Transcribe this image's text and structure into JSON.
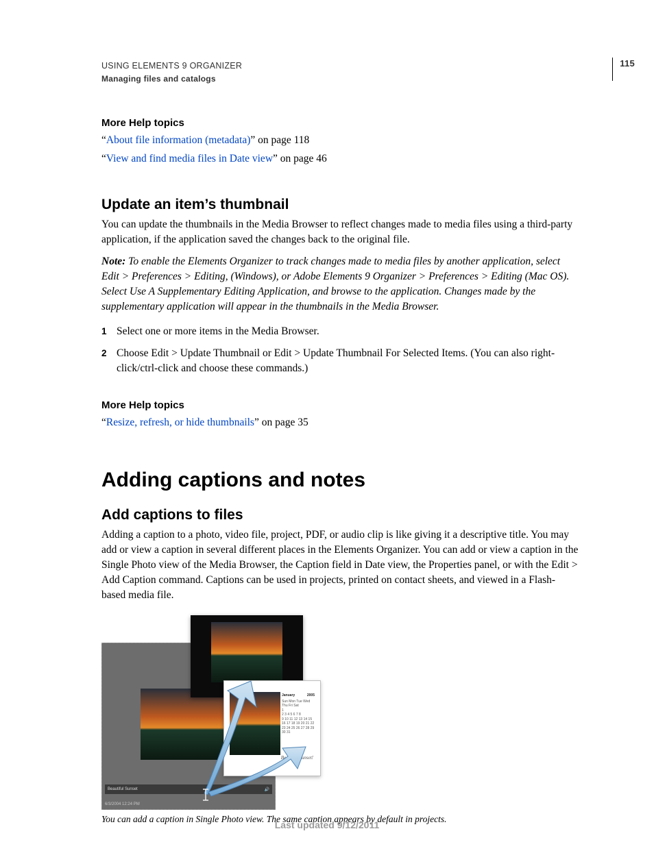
{
  "header": {
    "line1": "USING ELEMENTS 9 ORGANIZER",
    "line2": "Managing files and catalogs",
    "page_number": "115"
  },
  "sections": {
    "help1": {
      "heading": "More Help topics",
      "links": [
        {
          "quote_open": "“",
          "text": "About file information (metadata)",
          "tail": "” on page 118"
        },
        {
          "quote_open": "“",
          "text": "View and find media files in Date view",
          "tail": "” on page 46"
        }
      ]
    },
    "updateThumb": {
      "heading": "Update an item’s thumbnail",
      "body": "You can update the thumbnails in the Media Browser to reflect changes made to media files using a third-party application, if the application saved the changes back to the original file.",
      "note_label": "Note:",
      "note_body": " To enable the Elements Organizer to track changes made to media files by another application, select Edit > Preferences > Editing, (Windows), or Adobe Elements 9 Organizer > Preferences > Editing (Mac OS). Select Use A Supplementary Editing Application, and browse to the application. Changes made by the supplementary application will appear in the thumbnails in the Media Browser.",
      "steps": [
        "Select one or more items in the Media Browser.",
        "Choose Edit > Update Thumbnail or Edit > Update Thumbnail For Selected Items. (You can also right-click/ctrl-click and choose these commands.)"
      ]
    },
    "help2": {
      "heading": "More Help topics",
      "links": [
        {
          "quote_open": "“",
          "text": "Resize, refresh, or hide thumbnails",
          "tail": "” on page 35"
        }
      ]
    },
    "chapter": {
      "title": "Adding captions and notes"
    },
    "addCaptions": {
      "heading": "Add captions to files",
      "body": "Adding a caption to a photo, video file, project, PDF, or audio clip is like giving it a descriptive title. You may add or view a caption in several different places in the Elements Organizer. You can add or view a caption in the Single Photo view of the Media Browser, the Caption field in Date view, the Properties panel, or with the Edit > Add Caption command. Captions can be used in projects, printed on contact sheets, and viewed in a Flash-based media file."
    },
    "figure": {
      "caption_text": "Beautiful sunset!",
      "beautiful_label": "Beautiful Sunset",
      "timestamp_label": "6/3/2004 12:24 PM",
      "calendar": {
        "month": "January",
        "year": "2005",
        "dow": "Sun Mon Tue Wed Thu Fri Sat",
        "row1": "                              1",
        "row2": "2   3   4   5   6   7   8",
        "row3": "9  10  11  12  13  14  15",
        "row4": "16 17 18 19 20 21 22",
        "row5": "23 24 25 26 27 28 29",
        "row6": "30 31"
      },
      "sheet_caption_italic": "Beautiful sunset!",
      "panel_caption": "Beautiful sunset!",
      "caption": "You can add a caption in Single Photo view. The same caption appears by default in projects."
    }
  },
  "footer": {
    "updated": "Last updated 9/12/2011"
  }
}
